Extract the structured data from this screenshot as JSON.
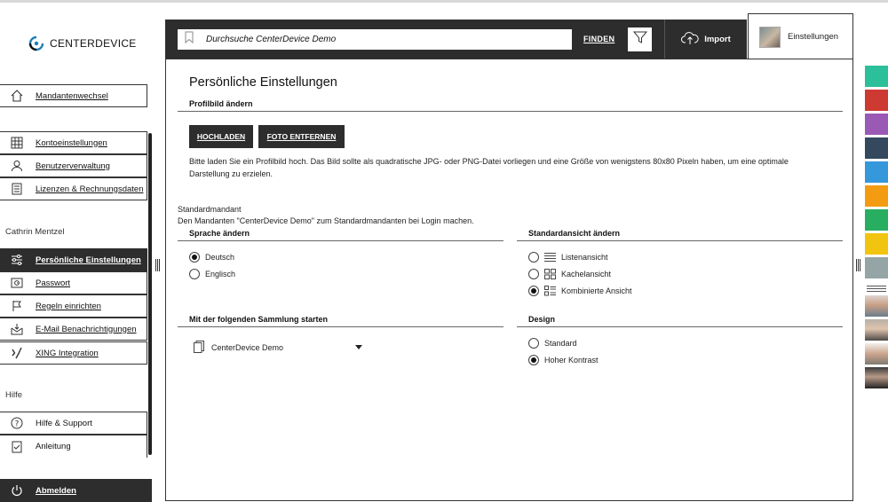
{
  "logo": {
    "text": "CENTERDEVICE"
  },
  "sidebar": {
    "mandant_item": {
      "label": "Mandantenwechsel",
      "icon": "home-icon"
    },
    "account_items": [
      {
        "label": "Kontoeinstellungen",
        "icon": "grid-icon"
      },
      {
        "label": "Benutzerverwaltung",
        "icon": "user-icon"
      },
      {
        "label": "Lizenzen & Rechnungsdaten",
        "icon": "invoice-icon"
      }
    ],
    "user_name": "Cathrin Mentzel",
    "user_items": [
      {
        "label": "Persönliche Einstellungen",
        "icon": "sliders-icon",
        "active": true
      },
      {
        "label": "Passwort",
        "icon": "lock-icon"
      },
      {
        "label": "Regeln einrichten",
        "icon": "flag-icon"
      },
      {
        "label": "E-Mail Benachrichtigungen",
        "icon": "mail-icon"
      },
      {
        "label": "XING Integration",
        "icon": "xing-icon"
      }
    ],
    "help_heading": "Hilfe",
    "help_items": [
      {
        "label": "Hilfe & Support",
        "icon": "help-icon"
      },
      {
        "label": "Anleitung",
        "icon": "manual-icon"
      }
    ],
    "logout": {
      "label": "Abmelden",
      "icon": "power-icon"
    }
  },
  "topbar": {
    "search_placeholder": "Durchsuche CenterDevice Demo",
    "search_button": "FINDEN",
    "import_label": "Import",
    "settings_tab": "Einstellungen"
  },
  "main": {
    "title": "Persönliche Einstellungen",
    "profile": {
      "heading": "Profilbild ändern",
      "upload_btn": "HOCHLADEN",
      "remove_btn": "FOTO ENTFERNEN",
      "hint_line1": "Bitte laden Sie ein Profilbild hoch. Das Bild sollte als quadratische JPG- oder PNG-Datei vorliegen und eine Größe von wenigstens 80x80 Pixeln haben, um eine optimale",
      "hint_line2": "Darstellung zu erzielen."
    },
    "default_mandant": {
      "label": "Standardmandant",
      "text": "Den Mandanten \"CenterDevice Demo\" zum Standardmandanten bei Login machen."
    },
    "language": {
      "heading": "Sprache ändern",
      "options": [
        {
          "label": "Deutsch",
          "selected": true
        },
        {
          "label": "Englisch",
          "selected": false
        }
      ]
    },
    "view": {
      "heading": "Standardansicht ändern",
      "options": [
        {
          "label": "Listenansicht",
          "selected": false,
          "icon": "list-view-icon"
        },
        {
          "label": "Kachelansicht",
          "selected": false,
          "icon": "tile-view-icon"
        },
        {
          "label": "Kombinierte Ansicht",
          "selected": true,
          "icon": "combined-view-icon"
        }
      ]
    },
    "collection": {
      "heading": "Mit der folgenden Sammlung starten",
      "selected": "CenterDevice Demo"
    },
    "design": {
      "heading": "Design",
      "options": [
        {
          "label": "Standard",
          "selected": false
        },
        {
          "label": "Hoher Kontrast",
          "selected": true
        }
      ]
    }
  },
  "palette": {
    "colors": [
      "#2bbf9a",
      "#cc3a32",
      "#9b59b6",
      "#34495e",
      "#3498db",
      "#f39c12",
      "#27ae60",
      "#f1c40f",
      "#95a5a6"
    ]
  }
}
